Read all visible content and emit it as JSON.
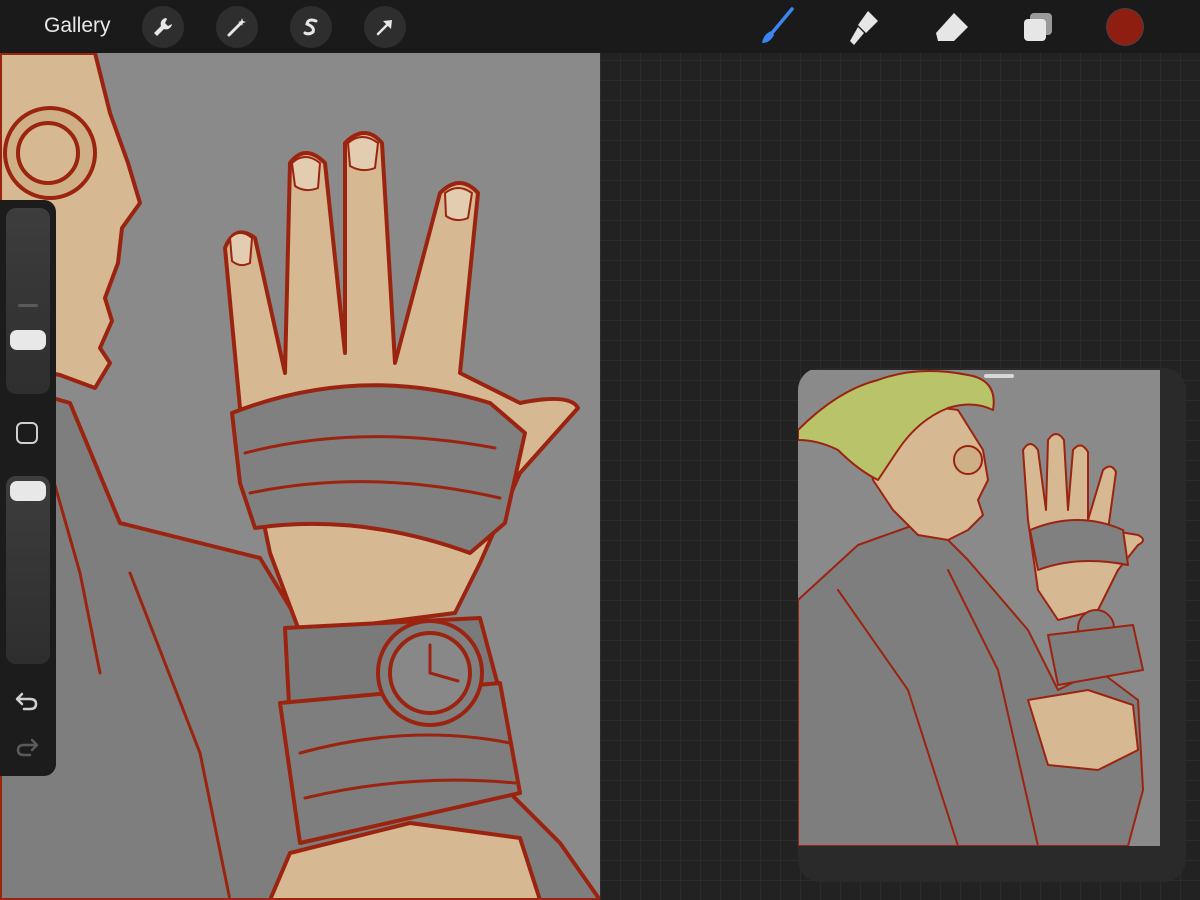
{
  "topbar": {
    "gallery_label": "Gallery",
    "left_tools": [
      "wrench-icon",
      "magic-wand-icon",
      "selection-icon",
      "transform-arrow-icon"
    ],
    "right_tools": [
      "brush-icon",
      "smudge-icon",
      "eraser-icon",
      "layers-icon"
    ],
    "active_tool": "brush-icon",
    "active_tool_color": "#3a86f0",
    "current_color": "#8e1f10"
  },
  "sidebar": {
    "brush_size_level": 0.45,
    "opacity_level": 0.95,
    "buttons": [
      "modifier-button",
      "undo-icon",
      "redo-icon"
    ]
  },
  "canvas": {
    "background_color": "#8a8a8a",
    "line_color": "#9b2410",
    "skin_color": "#d6b892"
  },
  "reference": {
    "window": "reference-window",
    "hair_color": "#b9c46a"
  }
}
